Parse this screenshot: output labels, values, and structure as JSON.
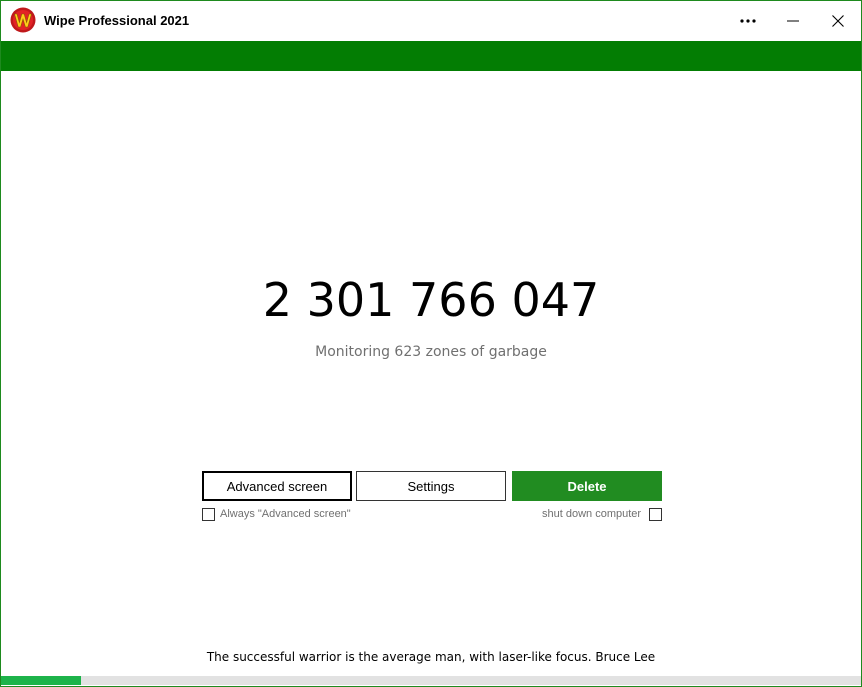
{
  "window": {
    "title": "Wipe Professional 2021",
    "accent_color": "#037d03",
    "icon": "wipe-logo-icon"
  },
  "titlebar_buttons": {
    "more": "⋯",
    "minimize": "—",
    "close": "✕"
  },
  "main": {
    "counter": "2 301 766 047",
    "subtitle": "Monitoring 623 zones of garbage"
  },
  "buttons": {
    "advanced_screen": "Advanced screen",
    "settings": "Settings",
    "delete": "Delete",
    "delete_color": "#218c21"
  },
  "options": {
    "always_advanced_label": "Always \"Advanced screen\"",
    "always_advanced_checked": false,
    "shutdown_label": "shut down computer",
    "shutdown_checked": false
  },
  "footer": {
    "quote": "The successful warrior is the average man, with laser-like focus. Bruce Lee",
    "progress_fraction": 0.093,
    "progress_color": "#1db34a"
  }
}
